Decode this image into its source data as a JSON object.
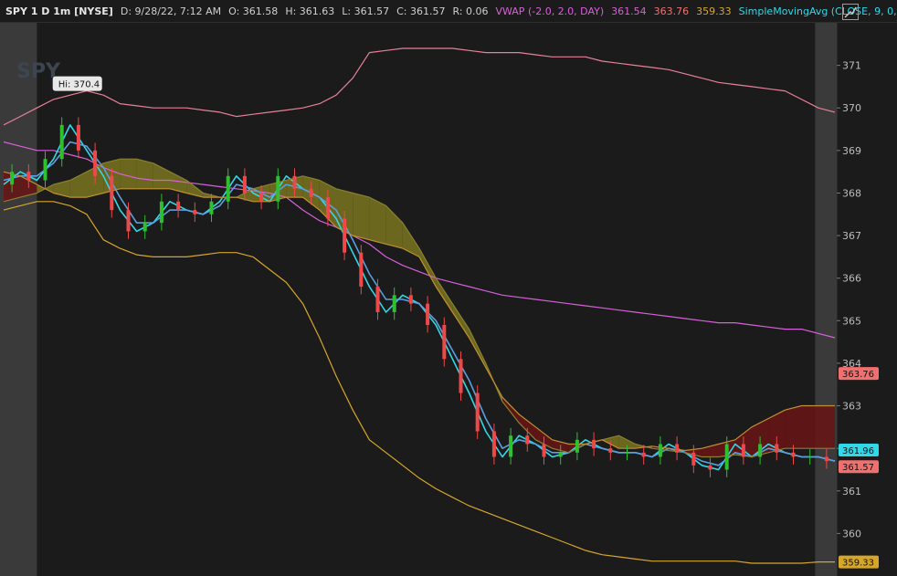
{
  "header": {
    "symbol": "SPY 1 D 1m [NYSE]",
    "date": "D: 9/28/22, 7:12 AM",
    "open": "O: 361.58",
    "high": "H: 361.63",
    "low": "L: 361.57",
    "close": "C: 361.57",
    "range": "R: 0.06",
    "vwap_label": "VWAP (-2.0, 2.0, DAY)",
    "vwap_mid": "361.54",
    "vwap_upper": "363.76",
    "vwap_lower": "359.33",
    "sma_label": "SimpleMovingAvg (CLOSE, 9, 0,..."
  },
  "watermark": "SPY",
  "colors": {
    "background": "#1b1b1b",
    "premarket": "#3a3a3a",
    "up_candle": "#2fbf2f",
    "down_candle": "#f04848",
    "cyan": "#30d8e8",
    "magenta": "#d860d8",
    "pink": "#e88098",
    "gold": "#d6a62a",
    "salmon": "#d86a5a",
    "cloud_bull": "#7a7420",
    "cloud_bear": "#6a1414"
  },
  "chart_data": {
    "type": "line",
    "title": "SPY 1 D 1m [NYSE]",
    "xlabel": "",
    "ylabel": "",
    "ylim": [
      359,
      372
    ],
    "yticks": [
      360,
      361,
      362,
      363,
      364,
      365,
      366,
      367,
      368,
      369,
      370,
      371
    ],
    "y_axis_position": "right",
    "grid": false,
    "hi_label": "Hi: 370.4",
    "hi_value": 370.4,
    "hi_x": 0.07,
    "premarket_end_x": 0.04,
    "postmarket_start_x": 0.985,
    "price_tags": [
      {
        "label": "363.76",
        "value": 363.76,
        "color": "#f07070"
      },
      {
        "label": "361.96",
        "value": 361.96,
        "color": "#30d8e8"
      },
      {
        "label": "361.57",
        "value": 361.57,
        "color": "#f07070"
      },
      {
        "label": "359.33",
        "value": 359.33,
        "color": "#d6a62a"
      }
    ],
    "x": [
      0.0,
      0.02,
      0.04,
      0.06,
      0.08,
      0.1,
      0.12,
      0.14,
      0.16,
      0.18,
      0.2,
      0.22,
      0.24,
      0.26,
      0.28,
      0.3,
      0.32,
      0.34,
      0.36,
      0.38,
      0.4,
      0.42,
      0.44,
      0.46,
      0.48,
      0.5,
      0.52,
      0.54,
      0.56,
      0.58,
      0.6,
      0.62,
      0.64,
      0.66,
      0.68,
      0.7,
      0.72,
      0.74,
      0.76,
      0.78,
      0.8,
      0.82,
      0.84,
      0.86,
      0.88,
      0.9,
      0.92,
      0.94,
      0.96,
      0.98,
      1.0
    ],
    "series": [
      {
        "name": "VWAP upper",
        "color": "#e88098",
        "values": [
          369.6,
          369.8,
          370.0,
          370.2,
          370.3,
          370.4,
          370.3,
          370.1,
          370.05,
          370.0,
          370.0,
          370.0,
          369.95,
          369.9,
          369.8,
          369.85,
          369.9,
          369.95,
          370.0,
          370.1,
          370.3,
          370.7,
          371.3,
          371.35,
          371.4,
          371.4,
          371.4,
          371.4,
          371.35,
          371.3,
          371.3,
          371.3,
          371.25,
          371.2,
          371.2,
          371.2,
          371.1,
          371.05,
          371.0,
          370.95,
          370.9,
          370.8,
          370.7,
          370.6,
          370.55,
          370.5,
          370.45,
          370.4,
          370.2,
          370.0,
          369.9
        ]
      },
      {
        "name": "VWAP",
        "color": "#d860d8",
        "values": [
          369.2,
          369.1,
          369.0,
          369.0,
          368.9,
          368.8,
          368.6,
          368.45,
          368.35,
          368.3,
          368.3,
          368.25,
          368.2,
          368.15,
          368.1,
          368.05,
          368.0,
          367.9,
          367.6,
          367.35,
          367.2,
          367.0,
          366.8,
          366.5,
          366.3,
          366.15,
          366.0,
          365.9,
          365.8,
          365.7,
          365.6,
          365.55,
          365.5,
          365.45,
          365.4,
          365.35,
          365.3,
          365.25,
          365.2,
          365.15,
          365.1,
          365.05,
          365.0,
          364.95,
          364.95,
          364.9,
          364.85,
          364.8,
          364.8,
          364.7,
          364.6
        ]
      },
      {
        "name": "VWAP lower",
        "color": "#d6a62a",
        "values": [
          367.6,
          367.7,
          367.8,
          367.8,
          367.7,
          367.5,
          366.9,
          366.7,
          366.55,
          366.5,
          366.5,
          366.5,
          366.55,
          366.6,
          366.6,
          366.5,
          366.2,
          365.9,
          365.4,
          364.6,
          363.7,
          362.9,
          362.2,
          361.9,
          361.6,
          361.3,
          361.05,
          360.85,
          360.65,
          360.5,
          360.35,
          360.2,
          360.05,
          359.9,
          359.75,
          359.6,
          359.5,
          359.45,
          359.4,
          359.35,
          359.35,
          359.35,
          359.35,
          359.35,
          359.35,
          359.3,
          359.3,
          359.3,
          359.3,
          359.33,
          359.33
        ]
      },
      {
        "name": "Price",
        "color": "#30d8e8",
        "values": [
          368.2,
          368.5,
          368.3,
          368.8,
          369.6,
          369.0,
          368.4,
          367.6,
          367.1,
          367.3,
          367.8,
          367.6,
          367.5,
          367.8,
          368.4,
          368.0,
          367.8,
          368.4,
          368.1,
          367.9,
          367.4,
          366.6,
          365.8,
          365.2,
          365.6,
          365.4,
          364.9,
          364.1,
          363.3,
          362.4,
          361.8,
          362.3,
          362.1,
          361.8,
          361.9,
          362.2,
          362.0,
          361.9,
          361.9,
          361.8,
          362.1,
          361.9,
          361.6,
          361.5,
          362.1,
          361.8,
          362.1,
          361.9,
          361.8,
          361.8,
          361.7
        ]
      },
      {
        "name": "SMA",
        "color": "#5aa0e0",
        "values": [
          368.3,
          368.4,
          368.4,
          368.7,
          369.2,
          369.1,
          368.6,
          367.9,
          367.3,
          367.3,
          367.6,
          367.6,
          367.5,
          367.7,
          368.2,
          368.1,
          367.9,
          368.2,
          368.1,
          367.9,
          367.6,
          366.9,
          366.1,
          365.5,
          365.5,
          365.4,
          365.0,
          364.3,
          363.6,
          362.7,
          362.0,
          362.2,
          362.1,
          361.9,
          361.9,
          362.1,
          362.0,
          361.9,
          361.9,
          361.8,
          362.0,
          361.9,
          361.7,
          361.6,
          361.9,
          361.8,
          362.0,
          361.9,
          361.8,
          361.8,
          361.7
        ]
      },
      {
        "name": "Cloud span A",
        "color": "#8a8030",
        "values": [
          367.8,
          367.9,
          368.0,
          368.2,
          368.3,
          368.5,
          368.7,
          368.8,
          368.8,
          368.7,
          368.5,
          368.3,
          368.0,
          367.9,
          367.9,
          368.1,
          368.2,
          368.3,
          368.4,
          368.3,
          368.1,
          368.0,
          367.9,
          367.7,
          367.3,
          366.7,
          366.0,
          365.4,
          364.8,
          364.0,
          363.1,
          362.6,
          362.2,
          362.0,
          361.9,
          362.1,
          362.2,
          362.3,
          362.1,
          362.0,
          361.95,
          361.9,
          361.8,
          361.8,
          361.85,
          361.8,
          361.9,
          362.0,
          362.0,
          362.0,
          362.0
        ]
      },
      {
        "name": "Cloud span B",
        "color": "#c09030",
        "values": [
          368.5,
          368.4,
          368.2,
          368.0,
          367.9,
          367.9,
          368.0,
          368.1,
          368.1,
          368.1,
          368.1,
          368.0,
          367.9,
          367.9,
          367.9,
          367.8,
          367.8,
          367.9,
          367.9,
          367.6,
          367.2,
          367.0,
          366.9,
          366.8,
          366.7,
          366.5,
          365.8,
          365.2,
          364.6,
          363.9,
          363.2,
          362.8,
          362.5,
          362.2,
          362.1,
          362.1,
          362.2,
          362.0,
          362.0,
          362.05,
          362.0,
          361.95,
          362.0,
          362.1,
          362.2,
          362.5,
          362.7,
          362.9,
          363.0,
          363.0,
          363.0
        ]
      }
    ]
  }
}
